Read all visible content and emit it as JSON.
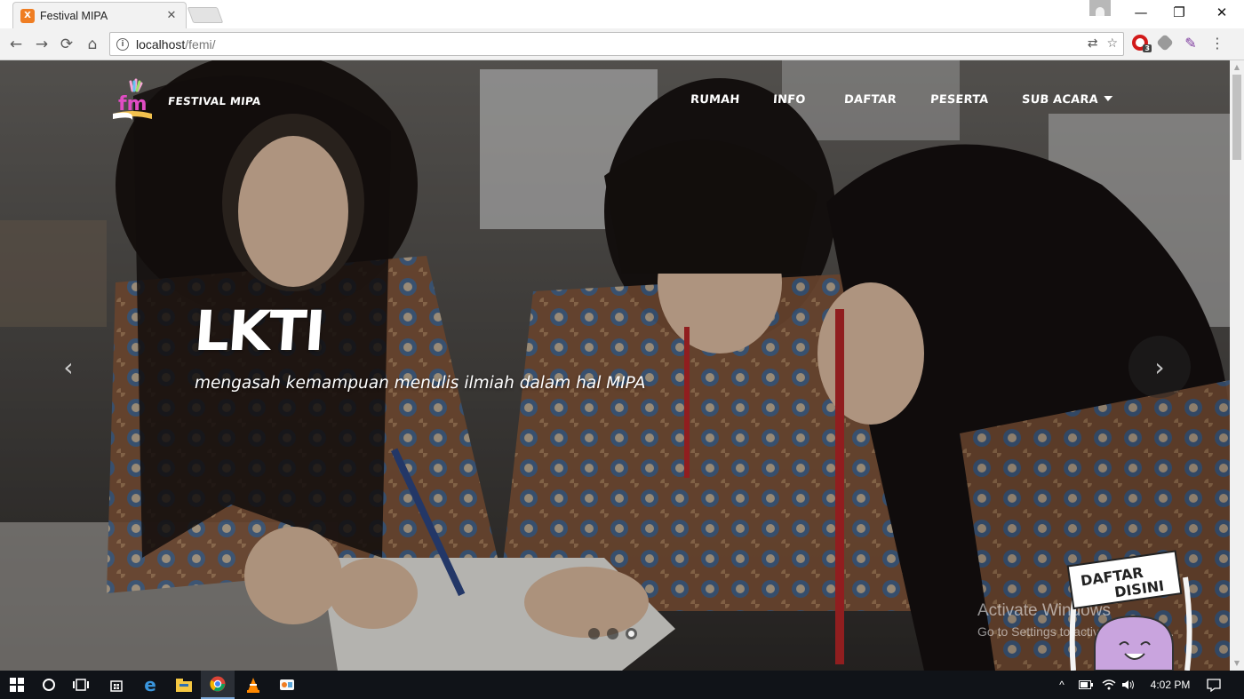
{
  "browser": {
    "tab_title": "Festival MIPA",
    "tab_favicon_letter": "X",
    "url_host": "localhost",
    "url_path": "/femi/",
    "extension_badge": "3"
  },
  "site": {
    "brand": "FESTIVAL MIPA",
    "brand_logo_letters": "fm",
    "nav": [
      "RUMAH",
      "INFO",
      "DAFTAR",
      "PESERTA",
      "SUB ACARA"
    ]
  },
  "carousel": {
    "title": "LKTI",
    "subtitle": "mengasah kemampuan menulis ilmiah dalam hal MIPA",
    "slide_count": 3,
    "active_slide": 3,
    "prev_symbol": "‹",
    "next_symbol": "›"
  },
  "badge": {
    "line1": "DAFTAR",
    "line2": "DISINI"
  },
  "watermark": {
    "line1": "Activate Windows",
    "line2": "Go to Settings to activate Windows."
  },
  "taskbar": {
    "time": "4:02 PM"
  },
  "colors": {
    "tab_favicon": "#ef7d22",
    "badge_ghost": "#c9a4de",
    "active_indicator": "#ffffff"
  }
}
